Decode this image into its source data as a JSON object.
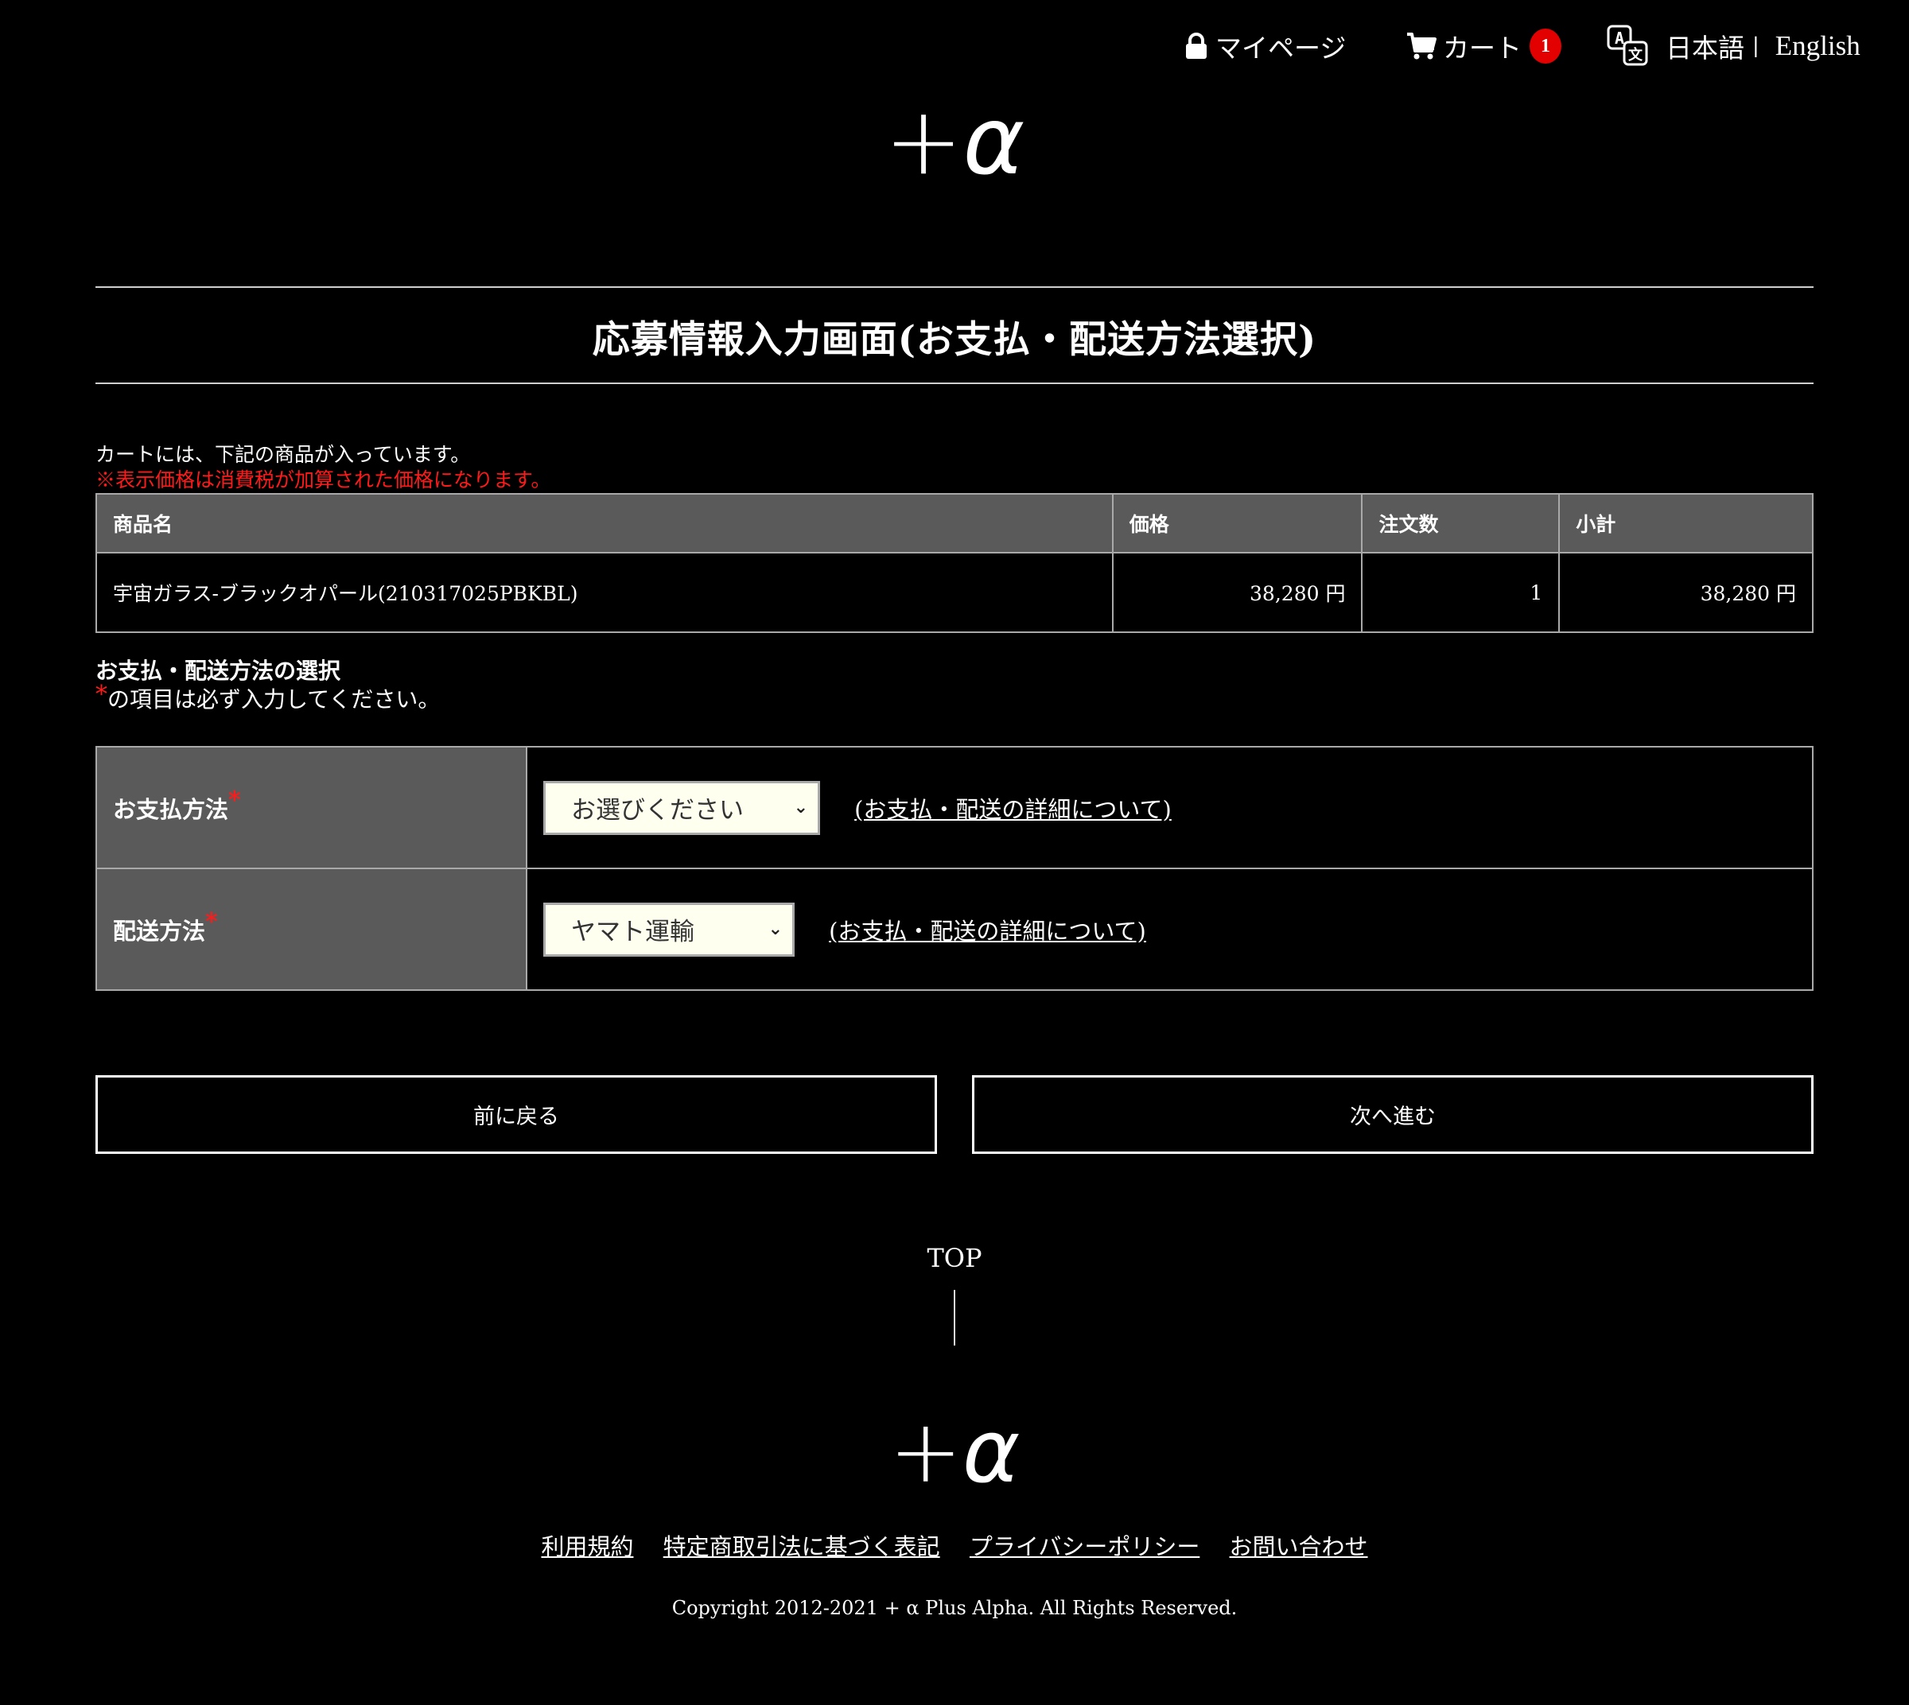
{
  "header": {
    "mypage_label": "マイページ",
    "cart_label": "カート",
    "cart_count": "1",
    "lang_japanese": "日本語",
    "lang_separator": "|",
    "lang_english": "English"
  },
  "logo": {
    "plus": "+",
    "alpha": "α"
  },
  "page_title": "応募情報入力画面(お支払・配送方法選択)",
  "cart_intro": "カートには、下記の商品が入っています。",
  "tax_note": "※表示価格は消費税が加算された価格になります。",
  "cart_table": {
    "headers": [
      "商品名",
      "価格",
      "注文数",
      "小計"
    ],
    "rows": [
      {
        "name": "宇宙ガラス-ブラックオパール(210317025PBKBL)",
        "price": "38,280 円",
        "quantity": "1",
        "subtotal": "38,280 円"
      }
    ]
  },
  "selection": {
    "heading": "お支払・配送方法の選択",
    "required_mark": "*",
    "required_note": "の項目は必ず入力してください。",
    "payment": {
      "label": "お支払方法",
      "selected": "お選びください",
      "detail_link": "(お支払・配送の詳細について)"
    },
    "delivery": {
      "label": "配送方法",
      "selected": "ヤマト運輸",
      "detail_link": "(お支払・配送の詳細について)"
    }
  },
  "buttons": {
    "back": "前に戻る",
    "next": "次へ進む"
  },
  "footer": {
    "top_label": "TOP",
    "links": [
      "利用規約",
      "特定商取引法に基づく表記",
      "プライバシーポリシー",
      "お問い合わせ"
    ],
    "copyright": "Copyright 2012-2021 + α  Plus Alpha. All Rights Reserved."
  },
  "colors": {
    "background": "#000000",
    "header_cell": "#5a5a5a",
    "border": "#a9a9a9",
    "accent_red": "#ff1a1a",
    "badge_red": "#e30000",
    "select_bg": "#fffff0"
  }
}
